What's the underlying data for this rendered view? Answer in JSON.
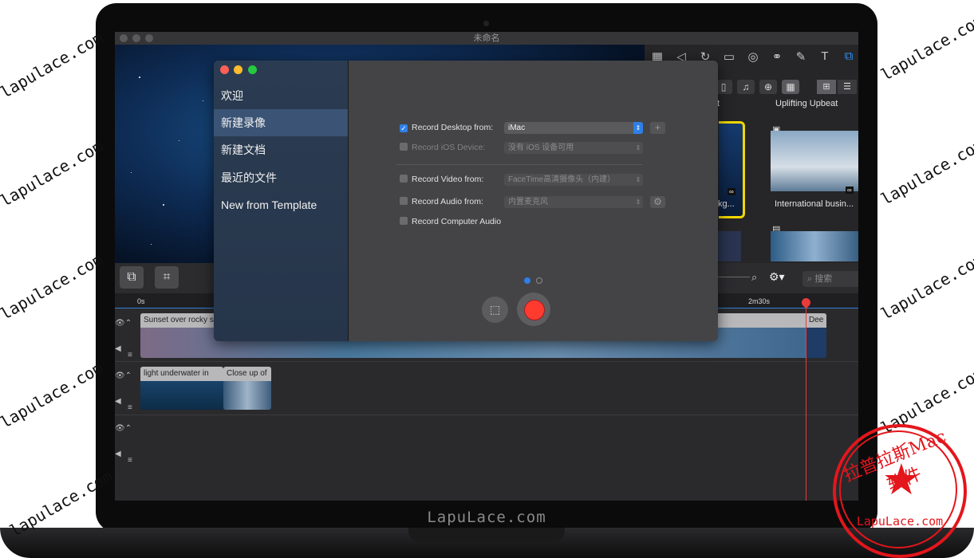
{
  "app": {
    "window_title": "未命名",
    "bezel_brand": "LapuLace.com"
  },
  "media": {
    "item_top_right": "Uplifting Upbeat",
    "item_partial_top": "t",
    "item_partial_mid": "kg...",
    "item_international": "International busin...",
    "infinity_badge": "∞"
  },
  "timeline": {
    "search_placeholder": "搜索",
    "ruler_start": "0s",
    "ruler_mark": "2m30s",
    "clip_sunset": "Sunset over rocky s",
    "clip_deep": "Dee",
    "clip_light": "light underwater in",
    "clip_close": "Close up of"
  },
  "dialog": {
    "nav": [
      {
        "label": "欢迎"
      },
      {
        "label": "新建录像"
      },
      {
        "label": "新建文档"
      },
      {
        "label": "最近的文件"
      },
      {
        "label": "New from Template"
      }
    ],
    "record_desktop": {
      "label": "Record Desktop from:",
      "value": "iMac",
      "checked": true
    },
    "record_ios": {
      "label": "Record iOS Device:",
      "value": "没有 iOS 设备可用"
    },
    "record_video": {
      "label": "Record Video from:",
      "value": "FaceTime高清摄像头（内建）"
    },
    "record_audio": {
      "label": "Record Audio from:",
      "value": "内置麦克风"
    },
    "record_computer_audio": {
      "label": "Record Computer Audio"
    }
  },
  "watermark": {
    "text": "lapulace.com",
    "seal_top": "拉普拉斯Mac软件",
    "seal_bottom": "LapuLace.com"
  },
  "colors": {
    "accent": "#2f7fe8",
    "record": "#ff3b30",
    "seal": "#e3161c",
    "selection_border": "#f0d800"
  }
}
